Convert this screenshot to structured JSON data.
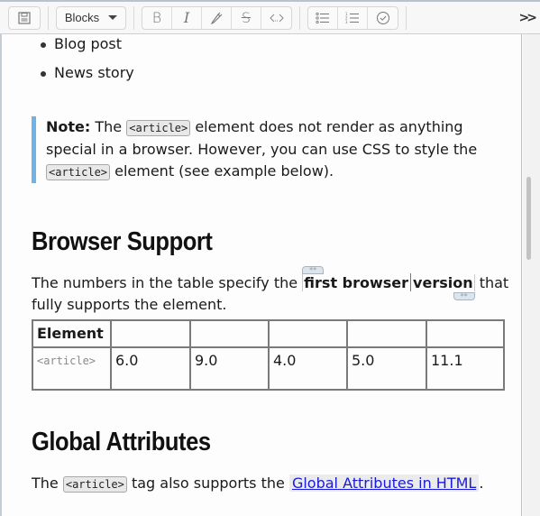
{
  "toolbar": {
    "save_icon": "floppy-disk-icon",
    "blocks_label": "Blocks",
    "format_buttons": [
      {
        "name": "bold",
        "glyph": "B"
      },
      {
        "name": "italic",
        "glyph": "I"
      },
      {
        "name": "highlight",
        "glyph": "✎"
      },
      {
        "name": "strikethrough",
        "glyph": "S"
      },
      {
        "name": "code",
        "glyph": "⟨⟩"
      }
    ],
    "list_buttons": [
      {
        "name": "bullet-list"
      },
      {
        "name": "numbered-list"
      },
      {
        "name": "checklist"
      }
    ],
    "more_label": ">>"
  },
  "content": {
    "bullets": [
      "Blog post",
      "News story"
    ],
    "note": {
      "label": "Note:",
      "text_1": " The ",
      "code_1": "<article>",
      "text_2": " element does not render as anything special in a browser. However, you can use CSS to style the ",
      "code_2": "<article>",
      "text_3": " element (see example below)."
    },
    "browser_support": {
      "heading": "Browser Support",
      "para_1": "The numbers in the table specify the ",
      "bold_1": "first browser",
      "bold_2": "version",
      "para_2": " that fully supports the element.",
      "marker_glyph": "**",
      "table": {
        "headers": [
          "Element",
          "",
          "",
          "",
          "",
          ""
        ],
        "rows": [
          [
            "<article>",
            "6.0",
            "9.0",
            "4.0",
            "5.0",
            "11.1"
          ]
        ]
      }
    },
    "global_attributes": {
      "heading": "Global Attributes",
      "text_1": "The ",
      "code": "<article>",
      "text_2": " tag also supports the ",
      "link": "Global Attributes in HTML",
      "text_3": "."
    }
  },
  "scrollbar": {
    "position_fraction": 0.3
  }
}
